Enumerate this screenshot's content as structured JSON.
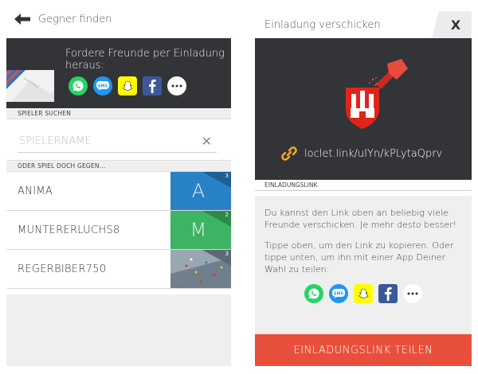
{
  "left": {
    "topbar": {
      "title": "Gegner finden",
      "back_icon": "arrow-left-icon"
    },
    "invite": {
      "text": "Fordere Freunde per Einladung heraus:",
      "icons": [
        {
          "name": "whatsapp-icon",
          "color": "#25d366"
        },
        {
          "name": "sms-icon",
          "color": "#2196f3",
          "label": "SMS"
        },
        {
          "name": "snapchat-icon",
          "color": "#fffc00"
        },
        {
          "name": "facebook-icon",
          "color": "#3b5998",
          "label": "f"
        },
        {
          "name": "more-icon",
          "color": "#ffffff",
          "label": "•••"
        }
      ]
    },
    "search_label": "SPIELER SUCHEN",
    "search": {
      "placeholder": "SPIELERNAME",
      "value": "",
      "clear": "✕"
    },
    "opponents_label": "ODER SPIEL DOCH GEGEN...",
    "opponents": [
      {
        "name": "ANIMA",
        "letter": "A",
        "badge": "3",
        "color": "#2a82c6"
      },
      {
        "name": "MUNTERERLUCHS8",
        "letter": "M",
        "badge": "2",
        "color": "#3cb464"
      },
      {
        "name": "REGERBIBER750",
        "letter": "",
        "badge": "3",
        "color": "#8a9aa8"
      }
    ]
  },
  "right": {
    "title": "Einladung verschicken",
    "close": "X",
    "link": "loclet.link/uIYn/kPLytaQprv",
    "section": "EINLADUNGSLINK",
    "para1": "Du kannst den Link oben an beliebig viele Freunde verschicken. Je mehr desto besser!",
    "para2": "Tippe oben, um den Link zu kopieren. Oder tippe unten, um ihn mit einer App Deiner Wahl zu teilen:",
    "share_button": "EINLADUNGSLINK TEILEN",
    "colors": {
      "accent": "#e8503c",
      "dark": "#323438"
    }
  }
}
